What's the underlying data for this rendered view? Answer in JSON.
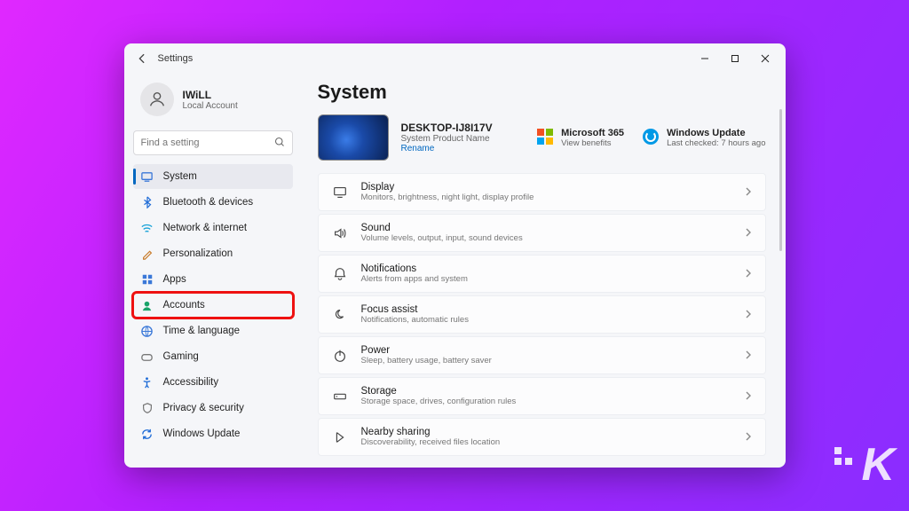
{
  "titlebar": {
    "title": "Settings"
  },
  "account": {
    "name": "IWiLL",
    "sub": "Local Account"
  },
  "search": {
    "placeholder": "Find a setting"
  },
  "nav": [
    {
      "label": "System",
      "icon": "system",
      "active": true,
      "highlight": false
    },
    {
      "label": "Bluetooth & devices",
      "icon": "bluetooth",
      "active": false,
      "highlight": false
    },
    {
      "label": "Network & internet",
      "icon": "network",
      "active": false,
      "highlight": false
    },
    {
      "label": "Personalization",
      "icon": "personalization",
      "active": false,
      "highlight": false
    },
    {
      "label": "Apps",
      "icon": "apps",
      "active": false,
      "highlight": false
    },
    {
      "label": "Accounts",
      "icon": "accounts",
      "active": false,
      "highlight": true
    },
    {
      "label": "Time & language",
      "icon": "timelang",
      "active": false,
      "highlight": false
    },
    {
      "label": "Gaming",
      "icon": "gaming",
      "active": false,
      "highlight": false
    },
    {
      "label": "Accessibility",
      "icon": "accessibility",
      "active": false,
      "highlight": false
    },
    {
      "label": "Privacy & security",
      "icon": "privacy",
      "active": false,
      "highlight": false
    },
    {
      "label": "Windows Update",
      "icon": "winupdate",
      "active": false,
      "highlight": false
    }
  ],
  "page": {
    "heading": "System",
    "device_name": "DESKTOP-IJ8I17V",
    "device_sub": "System Product Name",
    "rename": "Rename",
    "m365": {
      "title": "Microsoft 365",
      "sub": "View benefits"
    },
    "wu": {
      "title": "Windows Update",
      "sub": "Last checked: 7 hours ago"
    },
    "items": [
      {
        "title": "Display",
        "sub": "Monitors, brightness, night light, display profile",
        "icon": "display"
      },
      {
        "title": "Sound",
        "sub": "Volume levels, output, input, sound devices",
        "icon": "sound"
      },
      {
        "title": "Notifications",
        "sub": "Alerts from apps and system",
        "icon": "notif"
      },
      {
        "title": "Focus assist",
        "sub": "Notifications, automatic rules",
        "icon": "focus"
      },
      {
        "title": "Power",
        "sub": "Sleep, battery usage, battery saver",
        "icon": "power"
      },
      {
        "title": "Storage",
        "sub": "Storage space, drives, configuration rules",
        "icon": "storage"
      },
      {
        "title": "Nearby sharing",
        "sub": "Discoverability, received files location",
        "icon": "nearby"
      }
    ]
  },
  "nav_icon_colors": {
    "system": "#3a78d8",
    "bluetooth": "#1e6bd6",
    "network": "#1aa3d8",
    "personalization": "#c87b2a",
    "apps": "#3a78d8",
    "accounts": "#1aa36a",
    "timelang": "#3a78d8",
    "gaming": "#777",
    "accessibility": "#1e6bd6",
    "privacy": "#777",
    "winupdate": "#1e6bd6"
  }
}
